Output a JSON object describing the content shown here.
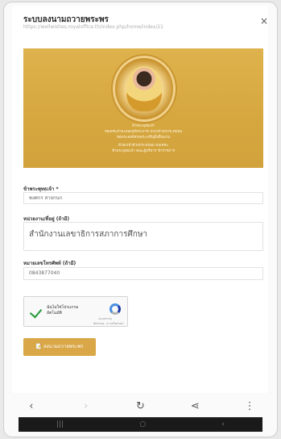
{
  "dialog": {
    "title": "ระบบลงนามถวายพระพร",
    "url": "https://wellwishes.royaloffice.th/index.php/home/index/21",
    "close_glyph": "×"
  },
  "banner": {
    "lines": [
      "ข้าพระพุทธเจ้า",
      "ขอเดชะฝ่าละอองธุลีพระบาท ปกเกล้าปกกระหม่อม",
      "ขอพระองค์ทรงพระเจริญยิ่งยืนนาน",
      "ด้วยเกล้าด้วยกระหม่อม ขอเดชะ",
      "ข้าพระพุทธเจ้า คณะผู้บริหาร ข้าราชการ"
    ]
  },
  "form": {
    "name_label": "ข้าพระพุทธเจ้า *",
    "name_value": "พงศกร สายกนก",
    "org_label": "หน่วยงาน/ที่อยู่ (ถ้ามี)",
    "org_value": "สำนักงานเลขาธิการสภาการศึกษา",
    "phone_label": "หมายเลขโทรศัพท์ (ถ้ามี)",
    "phone_value": "0843877040",
    "captcha_label_line1": "ฉันไม่ใช่โปรแกรม",
    "captcha_label_line2": "อัตโนมัติ",
    "captcha_small": "reCAPTCHA",
    "captcha_terms": "ข้อกำหนด · ความเป็นส่วนตัว",
    "submit_label": "ลงนามถวายพระพร",
    "submit_icon": "📝"
  },
  "browser_nav": {
    "back": "‹",
    "forward": "›",
    "reload": "↻",
    "share": "⋖",
    "more": "⋮"
  },
  "system_nav": {
    "recents": "|||",
    "home": "○",
    "back": "‹"
  }
}
